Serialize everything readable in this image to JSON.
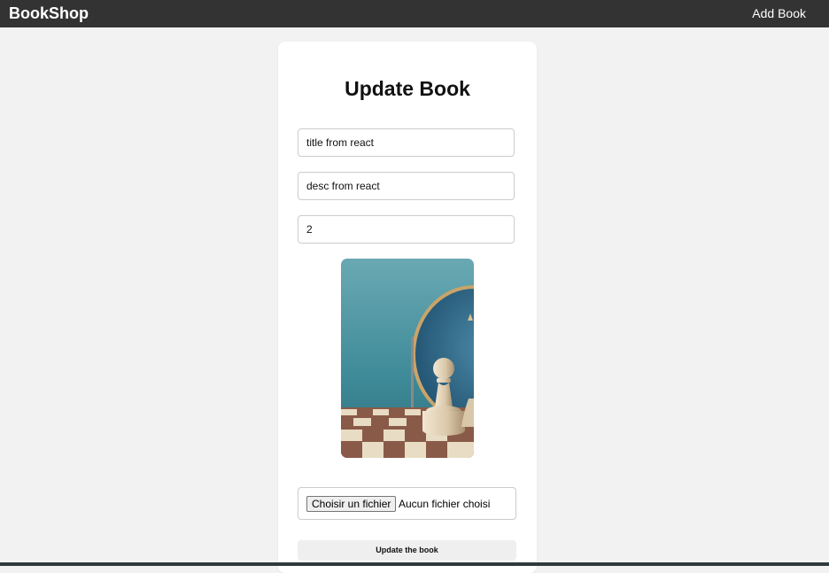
{
  "navbar": {
    "brand": "BookShop",
    "add_book_label": "Add Book"
  },
  "form": {
    "heading": "Update Book",
    "title_value": "title from react",
    "desc_value": "desc from react",
    "price_value": "2",
    "file_button_label": "Choisir un fichier",
    "file_status": "Aucun fichier choisi",
    "submit_label": "Update the book"
  },
  "colors": {
    "navbar_bg": "#333333",
    "page_bg": "#f2f2f2",
    "card_bg": "#ffffff"
  },
  "icons": {
    "cover": "chess-pawn-mirror-cover-image"
  }
}
